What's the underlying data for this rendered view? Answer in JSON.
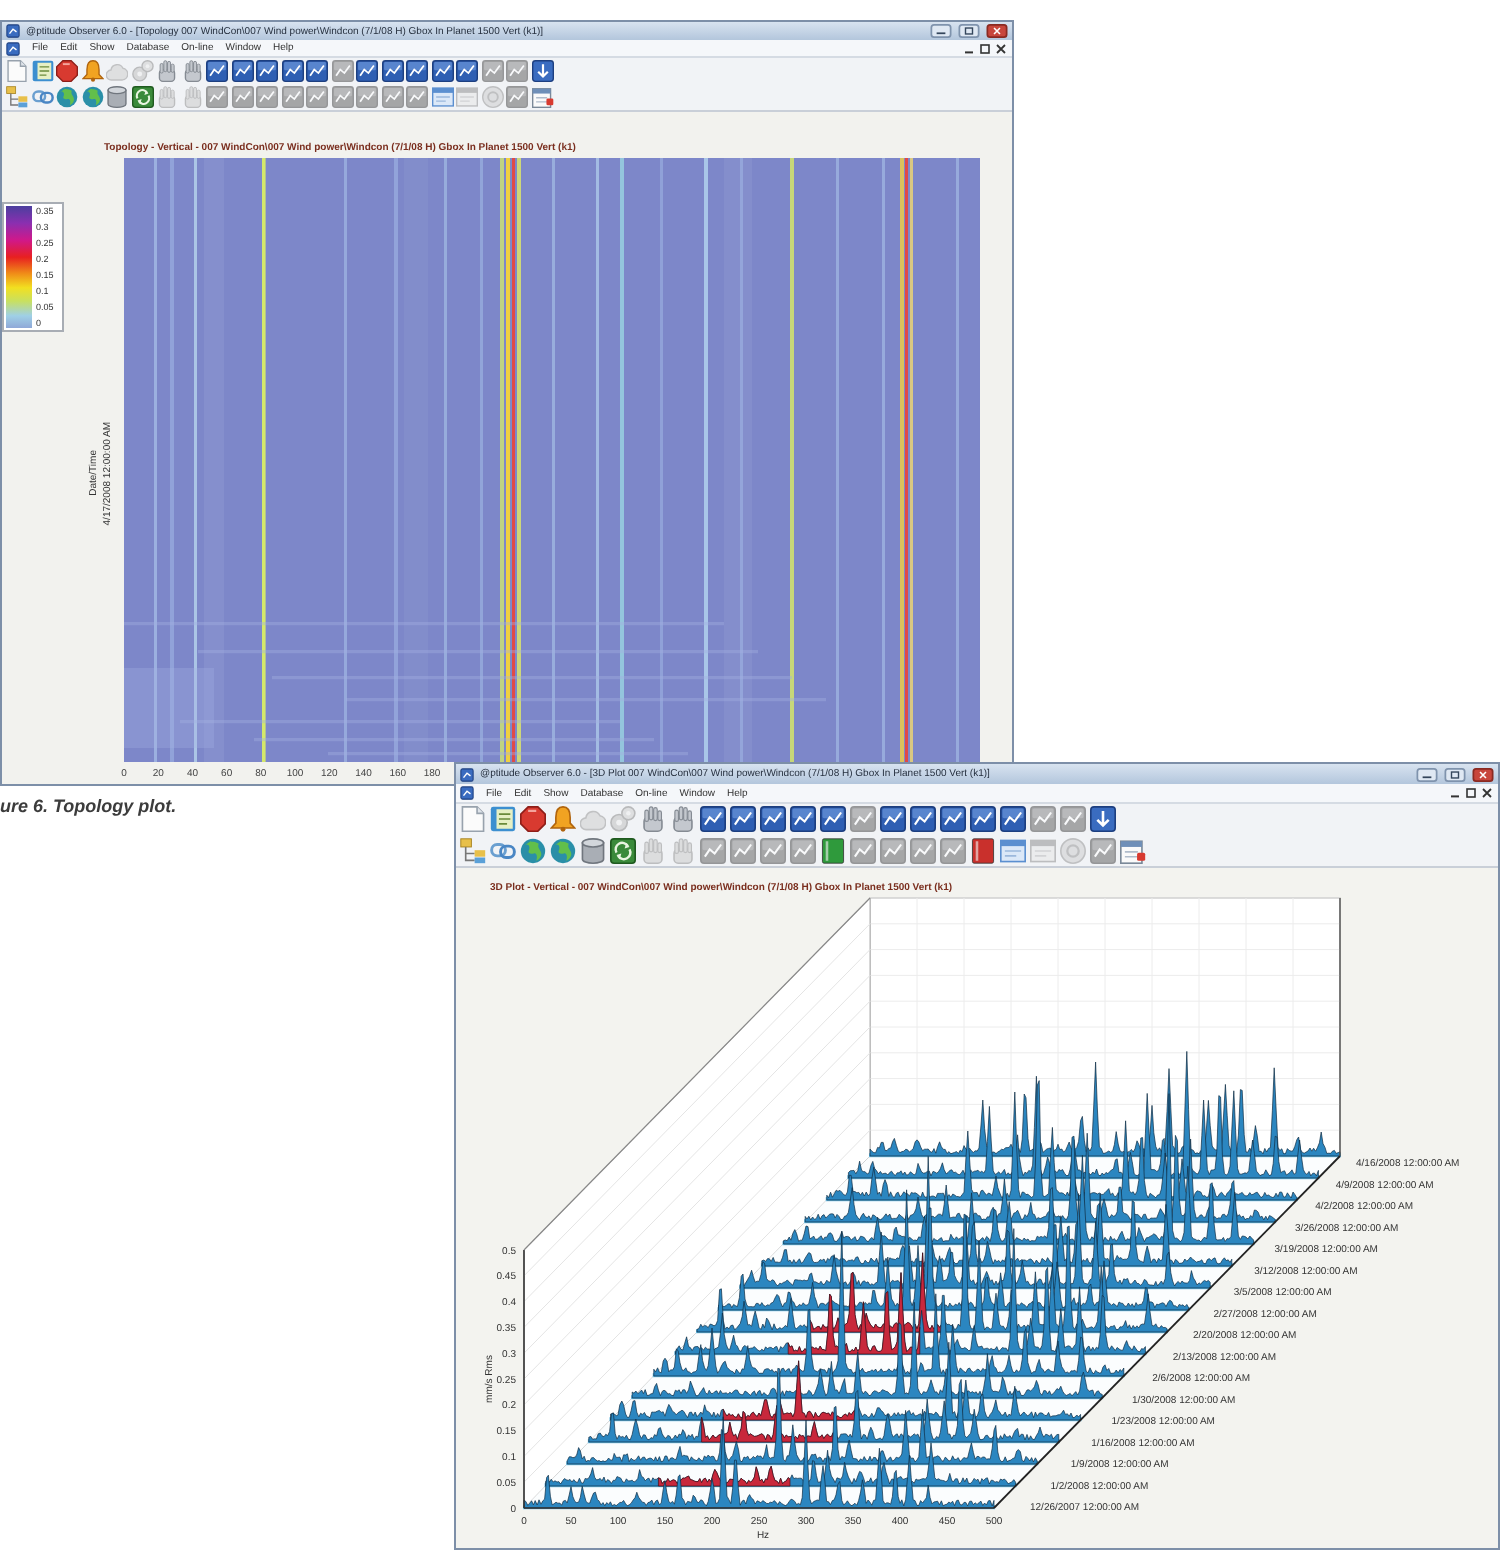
{
  "topology_window": {
    "title": "@ptitude Observer 6.0 - [Topology 007 WindCon\\007 Wind power\\Windcon (7/1/08 H) Gbox In Planet 1500 Vert (k1)]",
    "menu": [
      "File",
      "Edit",
      "Show",
      "Database",
      "On-line",
      "Window",
      "Help"
    ],
    "toolbars": [
      [
        {
          "kind": "page",
          "disabled": false
        },
        {
          "kind": "notebook",
          "disabled": false
        },
        {
          "kind": "stop",
          "disabled": false
        },
        {
          "kind": "bell",
          "disabled": false
        },
        {
          "kind": "cloud",
          "disabled": true
        },
        {
          "kind": "gears",
          "disabled": true
        },
        {
          "kind": "hand",
          "disabled": false
        },
        {
          "kind": "hand",
          "disabled": false
        },
        {
          "kind": "chart",
          "disabled": false
        },
        {
          "kind": "chart",
          "disabled": false
        },
        {
          "kind": "chart",
          "disabled": false
        },
        {
          "kind": "chart",
          "disabled": false
        },
        {
          "kind": "chart",
          "disabled": false
        },
        {
          "kind": "chart",
          "disabled": true
        },
        {
          "kind": "chart",
          "disabled": false
        },
        {
          "kind": "chart",
          "disabled": false
        },
        {
          "kind": "chart",
          "disabled": false
        },
        {
          "kind": "chart",
          "disabled": false
        },
        {
          "kind": "chart",
          "disabled": false
        },
        {
          "kind": "chart",
          "disabled": true
        },
        {
          "kind": "chart",
          "disabled": true
        },
        {
          "kind": "download",
          "disabled": false
        }
      ],
      [
        {
          "kind": "tree",
          "disabled": false
        },
        {
          "kind": "link",
          "disabled": false
        },
        {
          "kind": "globe",
          "disabled": false
        },
        {
          "kind": "globe",
          "disabled": false
        },
        {
          "kind": "db",
          "disabled": false
        },
        {
          "kind": "recycle",
          "disabled": false
        },
        {
          "kind": "hand",
          "disabled": true
        },
        {
          "kind": "hand",
          "disabled": true
        },
        {
          "kind": "chart",
          "disabled": true
        },
        {
          "kind": "chart",
          "disabled": true
        },
        {
          "kind": "chart",
          "disabled": true
        },
        {
          "kind": "chart",
          "disabled": true
        },
        {
          "kind": "chart",
          "disabled": true
        },
        {
          "kind": "chart",
          "disabled": true
        },
        {
          "kind": "chart",
          "disabled": true
        },
        {
          "kind": "chart",
          "disabled": true
        },
        {
          "kind": "chart",
          "disabled": true
        },
        {
          "kind": "window",
          "disabled": false
        },
        {
          "kind": "window",
          "disabled": true
        },
        {
          "kind": "disc",
          "disabled": true
        },
        {
          "kind": "chart",
          "disabled": true
        },
        {
          "kind": "calendar",
          "disabled": false
        }
      ]
    ],
    "plot": {
      "title": "Topology - Vertical - 007 WindCon\\007 Wind power\\Windcon (7/1/08 H) Gbox In Planet 1500 Vert (k1)",
      "legend": [
        "0.35",
        "0.3",
        "0.25",
        "0.2",
        "0.15",
        "0.1",
        "0.05",
        "0"
      ],
      "y_axis": {
        "title": "Date/Time",
        "value": "4/17/2008 12:00:00 AM"
      },
      "x_ticks": [
        "0",
        "20",
        "40",
        "60",
        "80",
        "100",
        "120",
        "140",
        "160",
        "180"
      ]
    }
  },
  "figure_caption": "ure 6. Topology plot.",
  "waterfall_window": {
    "title": "@ptitude Observer 6.0 - [3D Plot 007 WindCon\\007 Wind power\\Windcon (7/1/08 H) Gbox In Planet 1500 Vert (k1)]",
    "menu": [
      "File",
      "Edit",
      "Show",
      "Database",
      "On-line",
      "Window",
      "Help"
    ],
    "toolbars": [
      [
        {
          "kind": "page",
          "disabled": false
        },
        {
          "kind": "notebook",
          "disabled": false
        },
        {
          "kind": "stop",
          "disabled": false
        },
        {
          "kind": "bell",
          "disabled": false
        },
        {
          "kind": "cloud",
          "disabled": true
        },
        {
          "kind": "gears",
          "disabled": true
        },
        {
          "kind": "hand",
          "disabled": false
        },
        {
          "kind": "hand",
          "disabled": false
        },
        {
          "kind": "chart",
          "disabled": false
        },
        {
          "kind": "chart",
          "disabled": false
        },
        {
          "kind": "chart",
          "disabled": false
        },
        {
          "kind": "chart",
          "disabled": false
        },
        {
          "kind": "chart",
          "disabled": false
        },
        {
          "kind": "chart",
          "disabled": true
        },
        {
          "kind": "chart",
          "disabled": false
        },
        {
          "kind": "chart",
          "disabled": false
        },
        {
          "kind": "chart",
          "disabled": false
        },
        {
          "kind": "chart",
          "disabled": false
        },
        {
          "kind": "chart",
          "disabled": false
        },
        {
          "kind": "chart",
          "disabled": true
        },
        {
          "kind": "chart",
          "disabled": true
        },
        {
          "kind": "download",
          "disabled": false
        }
      ],
      [
        {
          "kind": "tree",
          "disabled": false
        },
        {
          "kind": "link",
          "disabled": false
        },
        {
          "kind": "globe",
          "disabled": false
        },
        {
          "kind": "globe",
          "disabled": false
        },
        {
          "kind": "db",
          "disabled": false
        },
        {
          "kind": "recycle",
          "disabled": false
        },
        {
          "kind": "hand",
          "disabled": true
        },
        {
          "kind": "hand",
          "disabled": true
        },
        {
          "kind": "chart",
          "disabled": true
        },
        {
          "kind": "chart",
          "disabled": true
        },
        {
          "kind": "chart",
          "disabled": true
        },
        {
          "kind": "chart",
          "disabled": true
        },
        {
          "kind": "book",
          "disabled": false,
          "color": "#2f9a3c"
        },
        {
          "kind": "chart",
          "disabled": true
        },
        {
          "kind": "chart",
          "disabled": true
        },
        {
          "kind": "chart",
          "disabled": true
        },
        {
          "kind": "chart",
          "disabled": true
        },
        {
          "kind": "book",
          "disabled": false,
          "color": "#c9302c"
        },
        {
          "kind": "window",
          "disabled": false
        },
        {
          "kind": "window",
          "disabled": true
        },
        {
          "kind": "disc",
          "disabled": true
        },
        {
          "kind": "chart",
          "disabled": true
        },
        {
          "kind": "calendar",
          "disabled": false
        }
      ]
    ],
    "plot": {
      "title": "3D Plot - Vertical - 007 WindCon\\007 Wind power\\Windcon (7/1/08 H) Gbox In Planet 1500 Vert (k1)",
      "y_axis": {
        "title": "mm/s Rms",
        "ticks": [
          "0.5",
          "0.45",
          "0.4",
          "0.35",
          "0.3",
          "0.25",
          "0.2",
          "0.15",
          "0.1",
          "0.05",
          "0"
        ]
      },
      "x_axis": {
        "title": "Hz",
        "ticks": [
          "0",
          "50",
          "100",
          "150",
          "200",
          "250",
          "300",
          "350",
          "400",
          "450",
          "500"
        ]
      },
      "dates": [
        "4/16/2008 12:00:00 AM",
        "4/9/2008 12:00:00 AM",
        "4/2/2008 12:00:00 AM",
        "3/26/2008 12:00:00 AM",
        "3/19/2008 12:00:00 AM",
        "3/12/2008 12:00:00 AM",
        "3/5/2008 12:00:00 AM",
        "2/27/2008 12:00:00 AM",
        "2/20/2008 12:00:00 AM",
        "2/13/2008 12:00:00 AM",
        "2/6/2008 12:00:00 AM",
        "1/30/2008 12:00:00 AM",
        "1/23/2008 12:00:00 AM",
        "1/16/2008 12:00:00 AM",
        "1/9/2008 12:00:00 AM",
        "1/2/2008 12:00:00 AM",
        "12/26/2007 12:00:00 AM"
      ]
    }
  }
}
